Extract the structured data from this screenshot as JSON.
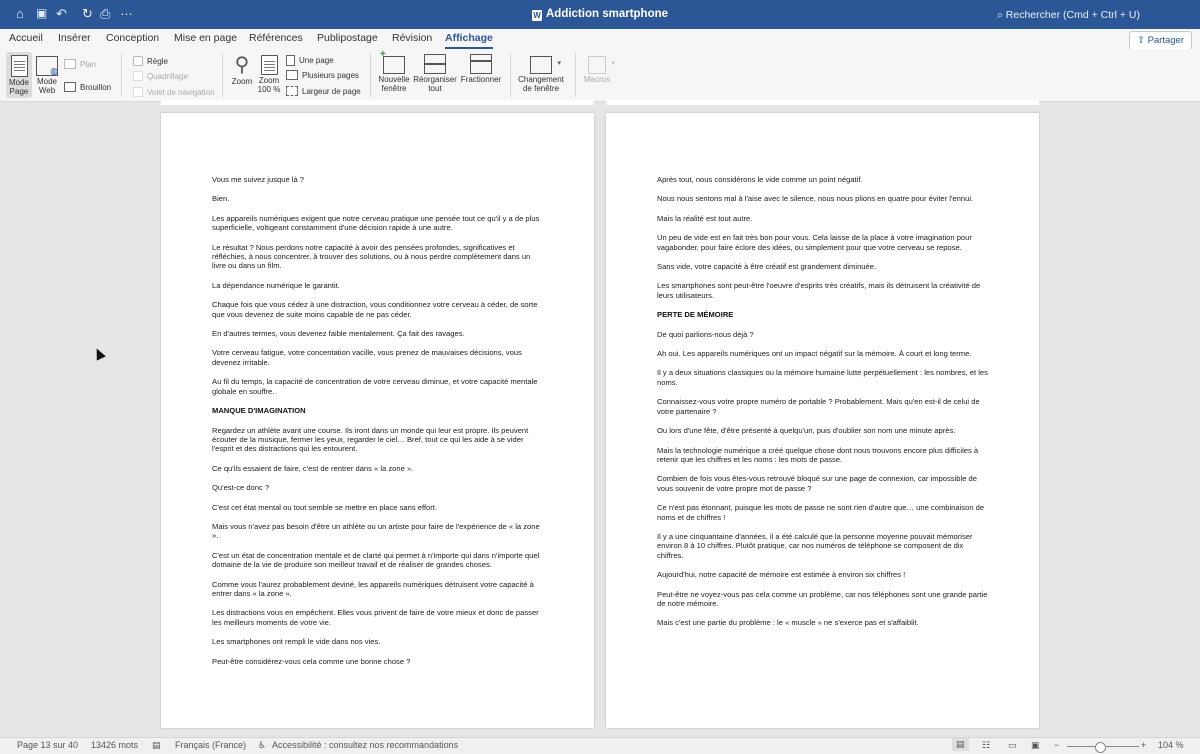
{
  "window": {
    "title": "Addiction smartphone",
    "search_placeholder": "Rechercher (Cmd + Ctrl + U)"
  },
  "tabs": [
    "Accueil",
    "Insérer",
    "Conception",
    "Mise en page",
    "Références",
    "Publipostage",
    "Révision",
    "Affichage"
  ],
  "active_tab": "Affichage",
  "share_label": "Partager",
  "ribbon": {
    "mode_page": [
      "Mode",
      "Page"
    ],
    "mode_web": [
      "Mode",
      "Web"
    ],
    "plan": "Plan",
    "brouillon": "Brouillon",
    "regle": "Règle",
    "quadrillage": "Quadrillage",
    "volet": "Volet de navigation",
    "zoom": "Zoom",
    "zoom100": [
      "Zoom",
      "100 %"
    ],
    "une_page": "Une page",
    "plusieurs_pages": "Plusieurs pages",
    "largeur_page": "Largeur de page",
    "nouvelle_fenetre": [
      "Nouvelle",
      "fenêtre"
    ],
    "reorganiser": [
      "Réorganiser",
      "tout"
    ],
    "fractionner": "Fractionner",
    "changement": [
      "Changement",
      "de fenêtre"
    ],
    "macros": "Macros"
  },
  "page_left": {
    "blocks": [
      {
        "t": "p",
        "text": "Vous me suivez jusque là ?"
      },
      {
        "t": "p",
        "text": "Bien."
      },
      {
        "t": "p",
        "text": "Les appareils numériques exigent que notre cerveau pratique une pensée tout ce qu'il y a de plus superficielle, voltigeant constamment d'une décision rapide à une autre."
      },
      {
        "t": "p",
        "text": "Le résultat ? Nous perdons notre capacité à avoir des pensées profondes, significatives et réfléchies, à nous concentrer, à trouver des solutions, ou à nous perdre complètement dans un livre ou dans un film."
      },
      {
        "t": "p",
        "text": "La dépendance numérique le garantit."
      },
      {
        "t": "p",
        "text": "Chaque fois que vous cédez à une distraction, vous conditionnez votre cerveau à céder, de sorte que vous devenez de suite moins capable de ne pas céder."
      },
      {
        "t": "p",
        "text": "En d'autres termes, vous devenez faible mentalement. Ça fait des ravages."
      },
      {
        "t": "p",
        "text": "Votre cerveau fatigue, votre concentation vacille, vous prenez de mauvaises décisions, vous devenez irritable."
      },
      {
        "t": "p",
        "text": "Au fil du temps, la capacité de concentration de votre cerveau diminue, et votre capacité mentale globale en souffre."
      },
      {
        "t": "h",
        "text": "MANQUE D'IMAGINATION"
      },
      {
        "t": "p",
        "text": "Regardez un athlète avant une course. Ils iront dans un monde qui leur est propre. Ils peuvent écouter de la musique, fermer les yeux, regarder le ciel… Bref, tout ce qui les aide à se vider l'esprit et des distractions qui les entourent."
      },
      {
        "t": "p",
        "text": "Ce qu'ils essaient de faire, c'est de rentrer dans « la zone »."
      },
      {
        "t": "p",
        "text": "Qu'est-ce donc ?"
      },
      {
        "t": "p",
        "text": "C'est cet état mental ou tout semble se mettre en place sans effort."
      },
      {
        "t": "p",
        "text": "Mais vous n'avez pas besoin d'être un athlète ou un artiste pour faire de l'expérience de « la zone »."
      },
      {
        "t": "p",
        "text": "C'est un état de concentration mentale et de clarté qui permet à n'importe qui dans n'importe quel domaine de la vie de produire son meilleur travail et de réaliser de grandes choses."
      },
      {
        "t": "p",
        "text": "Comme vous l'aurez probablement deviné, les appareils numériques détruisent votre capacité à entrer dans « la zone »."
      },
      {
        "t": "p",
        "text": "Les distractions vous en empêchent. Elles vous privent de faire de votre mieux et donc de passer les meilleurs moments de votre vie."
      },
      {
        "t": "p",
        "text": "Les smartphones ont rempli le vide dans nos vies."
      },
      {
        "t": "p",
        "text": "Peut-être considérez-vous cela comme une bonne chose ?"
      }
    ]
  },
  "page_right": {
    "blocks": [
      {
        "t": "p",
        "text": "Après tout, nous considérons le vide comme un point négatif."
      },
      {
        "t": "p",
        "text": "Nous nous sentons mal à l'aise avec le silence, nous nous plions en quatre pour éviter l'ennui."
      },
      {
        "t": "p",
        "text": "Mais la réalité est tout autre."
      },
      {
        "t": "p",
        "text": "Un peu de vide est en fait très bon pour vous. Cela laisse de la place à votre imagination pour vagabonder, pour faire éclore des idées, ou simplement pour que votre cerveau se repose."
      },
      {
        "t": "p",
        "text": "Sans vide, votre capacité à être créatif est grandement diminuée."
      },
      {
        "t": "p",
        "text": "Les smartphones sont peut-être l'oeuvre d'esprits très créatifs, mais ils détruisent la créativité de leurs utilisateurs."
      },
      {
        "t": "h",
        "text": "PERTE DE MÉMOIRE"
      },
      {
        "t": "p",
        "text": "De quoi parlions-nous déjà ?"
      },
      {
        "t": "p",
        "text": "Ah oui. Les appareils numériques ont un impact négatif sur la mémoire. À court et long terme."
      },
      {
        "t": "p",
        "text": "Il y a deux situations classiques ou la mémoire humaine lutte perpétuellement : les nombres, et les noms."
      },
      {
        "t": "p",
        "text": "Connaissez-vous votre propre numéro de portable ? Probablement. Mais qu'en est-il de celui de votre partenaire ?"
      },
      {
        "t": "p",
        "text": "Ou lors d'une fête, d'être présenté à quelqu'un, puis d'oublier son nom une minute après."
      },
      {
        "t": "p",
        "text": "Mais la technologie numérique a créé quelque chose dont nous trouvons encore plus difficiles à retenir que les chiffres et les noms : les mots de passe."
      },
      {
        "t": "p",
        "text": "Combien de fois vous êtes-vous retrouvé bloqué sur une page de connexion, car impossible de vous souvenir de votre propre mot de passe ?"
      },
      {
        "t": "p",
        "text": "Ce n'est pas étonnant, puisque les mots de passe ne sont rien d'autre que… une combinaison de noms et de chiffres !"
      },
      {
        "t": "p",
        "text": "Il y a une cinquantaine d'années, il a été calculé que la personne moyenne pouvait mémoriser environ 8 à 10 chiffres. Plutôt pratique, car nos numéros de téléphone se composent de dix chiffres."
      },
      {
        "t": "p",
        "text": "Aujourd'hui, notre capacité de mémoire est estimée à environ six chiffres !"
      },
      {
        "t": "p",
        "text": "Peut-être ne voyez-vous pas cela comme un problème, car nos téléphones sont une grande partie de notre mémoire."
      },
      {
        "t": "p",
        "text": "Mais c'est une partie du problème : le « muscle » ne s'exerce pas et s'affaiblit."
      }
    ]
  },
  "status": {
    "page": "Page 13 sur 40",
    "words": "13426 mots",
    "language": "Français (France)",
    "accessibility": "Accessibilité : consultez nos recommandations",
    "zoom": "104 %"
  }
}
